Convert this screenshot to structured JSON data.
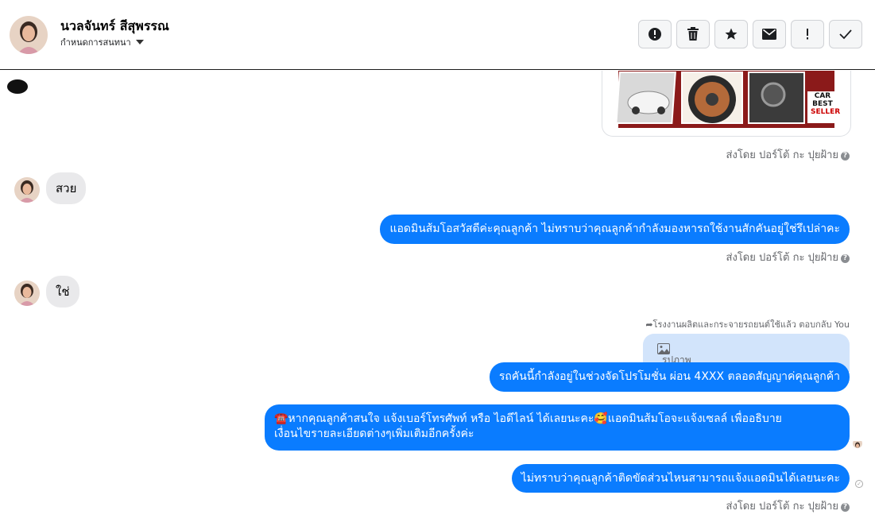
{
  "header": {
    "name": "นวลจันทร์ สีสุพรรณ",
    "subtitle": "กำหนดการสนทนา"
  },
  "actions": [
    {
      "icon": "alert-circle-icon"
    },
    {
      "icon": "trash-icon"
    },
    {
      "icon": "star-icon"
    },
    {
      "icon": "mail-icon"
    },
    {
      "icon": "exclamation-icon"
    },
    {
      "icon": "check-icon"
    }
  ],
  "image_card": {
    "badge_line1": "CAR",
    "badge_line2": "BEST",
    "badge_line3": "SELLER"
  },
  "sent_by": "ส่งโดย ปอร์โต้ กะ ปุยฝ้าย",
  "help_glyph": "?",
  "messages": {
    "in1": "สวย",
    "out1": "แอดมินส้มโอสวัสดีค่ะคุณลูกค้า ไม่ทราบว่าคุณลูกค้ากำลังมองหารถใช้งานสักคันอยู่ใช่รึเปล่าคะ",
    "in2": "ใช่",
    "reply_meta": "โรงงานผลิตและกระจายรถยนต์ใช้แล้ว ตอบกลับ You",
    "reply_preview": "รูปภาพ",
    "out2": "รถคันนี้กำลังอยู่ในช่วงจัดโปรโมชั่น ผ่อน 4XXX ตลอดสัญญาค่คุณลูกค้า",
    "out3_line1": "☎️หากคุณลูกค้าสนใจ แจ้งเบอร์โทรศัพท์ หรือ ไอดีไลน์  ได้เลยนะคะ🥰แอดมินส้มโอจะแจ้งเซลล์   เพื่ออธิบาย",
    "out3_line2": "เงื่อนไขรายละเอียดต่างๆเพิ่มเติมอีกครั้งค่ะ",
    "out4": "ไม่ทราบว่าคุณลูกค้าติดขัดส่วนไหนสามารถแจ้งแอดมินได้เลยนะคะ"
  },
  "colors": {
    "bubble_out": "#0a7cff",
    "bubble_in": "#e9e9eb",
    "reply_box": "#d2e4fb"
  }
}
